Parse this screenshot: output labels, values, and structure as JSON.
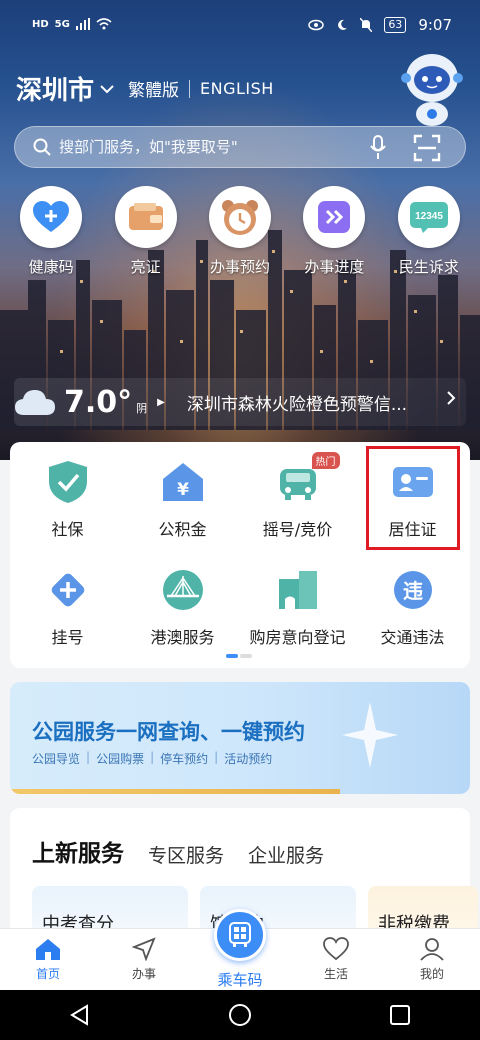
{
  "status_bar": {
    "left_badges": [
      "HD",
      "5G"
    ],
    "battery": "63",
    "time": "9:07"
  },
  "header": {
    "city": "深圳市",
    "lang_traditional": "繁體版",
    "lang_english": "ENGLISH"
  },
  "search": {
    "placeholder": "搜部门服务，如\"我要取号\""
  },
  "quick_actions": [
    {
      "label": "健康码",
      "icon": "health-code-icon"
    },
    {
      "label": "亮证",
      "icon": "wallet-icon"
    },
    {
      "label": "办事预约",
      "icon": "appointment-bear-icon"
    },
    {
      "label": "办事进度",
      "icon": "progress-icon"
    },
    {
      "label": "民生诉求",
      "icon": "hotline-12345-icon"
    }
  ],
  "weather": {
    "temperature": "7.0°",
    "condition": "阴",
    "alert": "深圳市森林火险橙色预警信..."
  },
  "services_grid": [
    {
      "label": "社保",
      "icon": "shield-check-icon"
    },
    {
      "label": "公积金",
      "icon": "housing-fund-icon"
    },
    {
      "label": "摇号/竞价",
      "icon": "car-icon",
      "badge": "热门"
    },
    {
      "label": "居住证",
      "icon": "id-card-icon"
    },
    {
      "label": "挂号",
      "icon": "medical-cross-icon"
    },
    {
      "label": "港澳服务",
      "icon": "bridge-icon"
    },
    {
      "label": "购房意向登记",
      "icon": "building-icon"
    },
    {
      "label": "交通违法",
      "icon": "traffic-violation-icon"
    }
  ],
  "banner": {
    "title": "公园服务一网查询、一键预约",
    "links": [
      "公园导览",
      "公园购票",
      "停车预约",
      "活动预约"
    ]
  },
  "service_tabs": [
    {
      "label": "上新服务",
      "active": true
    },
    {
      "label": "专区服务",
      "active": false
    },
    {
      "label": "企业服务",
      "active": false
    }
  ],
  "service_cards": [
    "中考查分",
    "馆预约",
    "非税缴费"
  ],
  "bottom_nav": [
    {
      "label": "首页",
      "icon": "home-icon",
      "active": true
    },
    {
      "label": "办事",
      "icon": "navigate-icon",
      "active": false
    },
    {
      "label": "乘车码",
      "icon": "bus-code-icon",
      "active": false
    },
    {
      "label": "生活",
      "icon": "heart-icon",
      "active": false
    },
    {
      "label": "我的",
      "icon": "user-icon",
      "active": false
    }
  ],
  "colors": {
    "accent": "#2c7df0",
    "highlight_box": "#e01b24",
    "hot_badge": "#d9534f",
    "banner_title": "#1b6fc0"
  }
}
